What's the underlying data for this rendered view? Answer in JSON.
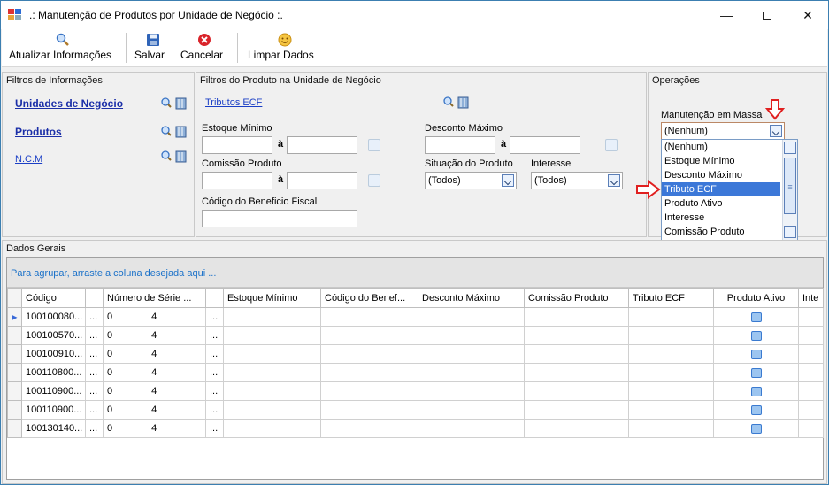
{
  "window": {
    "title": ".: Manutenção de Produtos por Unidade de Negócio :."
  },
  "toolbar": {
    "buttons": [
      {
        "label": "Atualizar Informações",
        "icon": "search-icon"
      },
      {
        "label": "Salvar",
        "icon": "save-icon"
      },
      {
        "label": "Cancelar",
        "icon": "cancel-icon"
      },
      {
        "label": "Limpar Dados",
        "icon": "clear-icon"
      }
    ]
  },
  "filtros_informacoes": {
    "title": "Filtros de Informações",
    "links": [
      "Unidades de Negócio",
      "Produtos",
      "N.C.M"
    ]
  },
  "filtros_produto": {
    "title": "Filtros do Produto na Unidade de Negócio",
    "tributos_link": "Tributos ECF",
    "estoque_minimo_label": "Estoque Mínimo",
    "comissao_label": "Comissão Produto",
    "codigo_beneficio_label": "Código do Beneficio Fiscal",
    "desconto_maximo_label": "Desconto Máximo",
    "situacao_label": "Situação do Produto",
    "situacao_value": "(Todos)",
    "interesse_label": "Interesse",
    "interesse_value": "(Todos)",
    "range_sep": "à"
  },
  "operacoes": {
    "title": "Operações",
    "manutencao_label": "Manutenção em Massa",
    "selected": "(Nenhum)",
    "options": [
      "(Nenhum)",
      "Estoque Mínimo",
      "Desconto Máximo",
      "Tributo ECF",
      "Produto Ativo",
      "Interesse",
      "Comissão Produto"
    ],
    "highlighted": "Tributo ECF"
  },
  "dados_gerais": {
    "title": "Dados Gerais",
    "group_hint": "Para agrupar, arraste a coluna desejada aqui ...",
    "columns": [
      "Código",
      "",
      "Número de Série ...",
      "",
      "Estoque Mínimo",
      "Código do Benef...",
      "Desconto Máximo",
      "Comissão Produto",
      "Tributo ECF",
      "Produto Ativo",
      "Inte"
    ],
    "rows": [
      {
        "codigo": "100100080...",
        "a": "...",
        "serie": "0",
        "serie_n": "4",
        "b": "..."
      },
      {
        "codigo": "100100570...",
        "a": "...",
        "serie": "0",
        "serie_n": "4",
        "b": "..."
      },
      {
        "codigo": "100100910...",
        "a": "...",
        "serie": "0",
        "serie_n": "4",
        "b": "..."
      },
      {
        "codigo": "100110800...",
        "a": "...",
        "serie": "0",
        "serie_n": "4",
        "b": "..."
      },
      {
        "codigo": "100110900...",
        "a": "...",
        "serie": "0",
        "serie_n": "4",
        "b": "..."
      },
      {
        "codigo": "100110900...",
        "a": "...",
        "serie": "0",
        "serie_n": "4",
        "b": "..."
      },
      {
        "codigo": "100130140...",
        "a": "...",
        "serie": "0",
        "serie_n": "4",
        "b": "..."
      }
    ]
  },
  "colors": {
    "accent": "#3c78d8",
    "link": "#1b2fa8",
    "hint": "#1c72c9",
    "arrow": "#e02020"
  }
}
